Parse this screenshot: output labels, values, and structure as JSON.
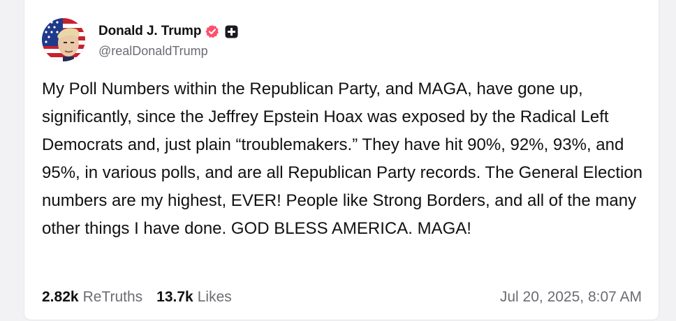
{
  "author": {
    "display_name": "Donald J. Trump",
    "handle": "@realDonaldTrump",
    "avatar_icon": "profile-avatar",
    "verified_icon": "verified-badge-icon",
    "verified_color": "#ff4f6d",
    "plus_icon": "truth-plus-icon"
  },
  "post": {
    "text": "My Poll Numbers within the Republican Party, and MAGA, have gone up, significantly, since the Jeffrey Epstein Hoax was exposed by the Radical Left Democrats and, just plain “troublemakers.” They have hit 90%, 92%, 93%, and 95%, in various polls, and are all Republican Party records. The General Election numbers are my highest, EVER! People like Strong Borders, and all of the many other things I have done. GOD BLESS AMERICA. MAGA!"
  },
  "stats": {
    "retruths_count": "2.82k",
    "retruths_label": "ReTruths",
    "likes_count": "13.7k",
    "likes_label": "Likes"
  },
  "timestamp": "Jul 20, 2025, 8:07 AM"
}
